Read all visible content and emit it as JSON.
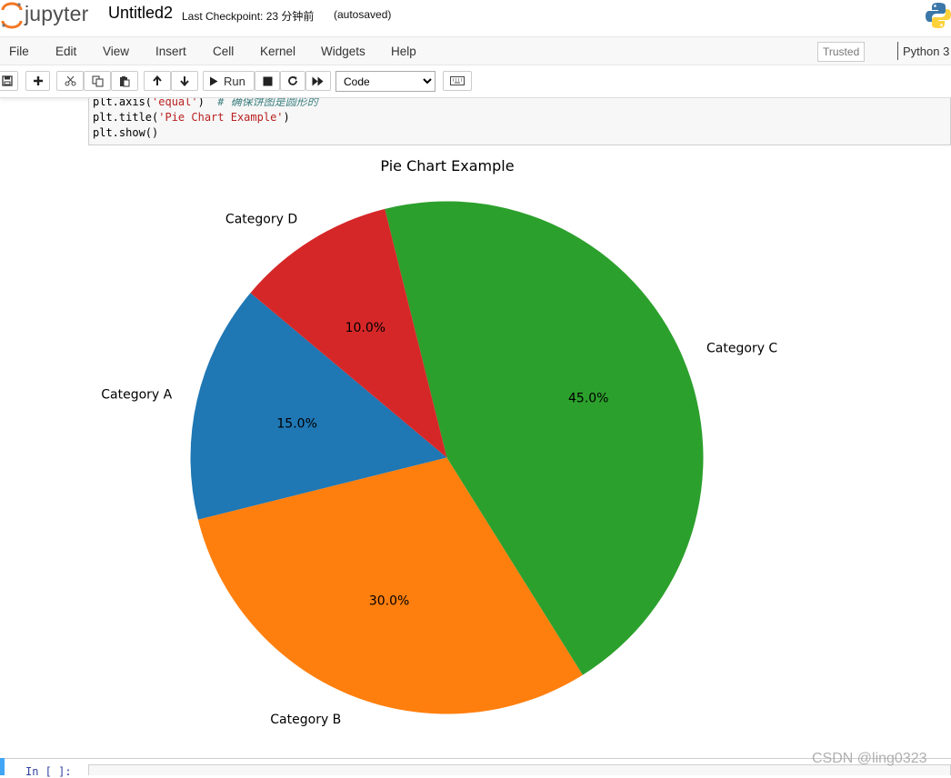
{
  "header": {
    "logo_text": "jupyter",
    "notebook_name": "Untitled2",
    "checkpoint": "Last Checkpoint: 23 分钟前",
    "autosave": "(autosaved)"
  },
  "menubar": {
    "items": [
      "File",
      "Edit",
      "View",
      "Insert",
      "Cell",
      "Kernel",
      "Widgets",
      "Help"
    ],
    "trusted_label": "Trusted",
    "kernel_name": "Python 3"
  },
  "toolbar": {
    "run_label": "Run",
    "cell_type_selected": "Code",
    "buttons": [
      "save-icon",
      "plus-icon",
      "scissors-icon",
      "copy-icon",
      "paste-icon",
      "arrow-up-icon",
      "arrow-down-icon",
      "play-icon",
      "stop-icon",
      "restart-icon",
      "fast-forward-icon",
      "keyboard-icon"
    ]
  },
  "code_cell": {
    "lines": [
      {
        "pre": "plt.axis(",
        "str": "'equal'",
        "post": ")  ",
        "comment": "# 确保饼图是圆形的"
      },
      {
        "pre": "plt.title(",
        "str": "'Pie Chart Example'",
        "post": ")",
        "comment": ""
      },
      {
        "pre": "plt.show()",
        "str": "",
        "post": "",
        "comment": ""
      }
    ]
  },
  "chart_data": {
    "type": "pie",
    "title": "Pie Chart Example",
    "categories": [
      "Category A",
      "Category B",
      "Category C",
      "Category D"
    ],
    "values": [
      15,
      30,
      45,
      10
    ],
    "value_labels": [
      "15.0%",
      "30.0%",
      "45.0%",
      "10.0%"
    ],
    "colors": [
      "#1f77b4",
      "#ff7f0e",
      "#2ca02c",
      "#d62728"
    ],
    "start_angle": 140
  },
  "next_cell": {
    "prompt": "In [ ]:"
  },
  "watermark": "CSDN @ling0323"
}
